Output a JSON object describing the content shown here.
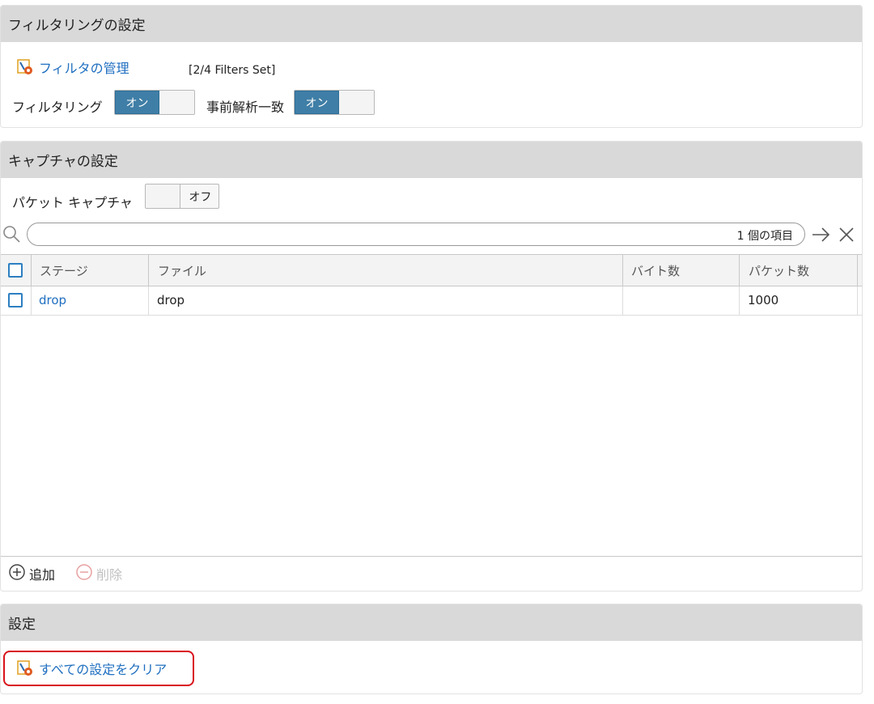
{
  "filtering": {
    "title": "フィルタリングの設定",
    "manage_link": "フィルタの管理",
    "filters_status": "[2/4 Filters Set]",
    "filtering_label": "フィルタリング",
    "filtering_toggle": "オン",
    "pre_parse_label": "事前解析一致",
    "pre_parse_toggle": "オン"
  },
  "capture": {
    "title": "キャプチャの設定",
    "packet_capture_label": "パケット キャプチャ",
    "packet_capture_toggle": "オフ",
    "search": {
      "placeholder": "",
      "count": "1 個の項目"
    },
    "columns": [
      "ステージ",
      "ファイル",
      "バイト数",
      "パケット数"
    ],
    "rows": [
      {
        "stage": "drop",
        "file": "drop",
        "bytes": "",
        "packets": "1000"
      }
    ],
    "add_label": "追加",
    "delete_label": "削除"
  },
  "settings": {
    "title": "設定",
    "clear_link": "すべての設定をクリア"
  },
  "colors": {
    "accent": "#1f6fc0",
    "toggle_on": "#3f7ea6",
    "highlight_border": "#d9121b",
    "header_bg": "#d9d9d9"
  }
}
